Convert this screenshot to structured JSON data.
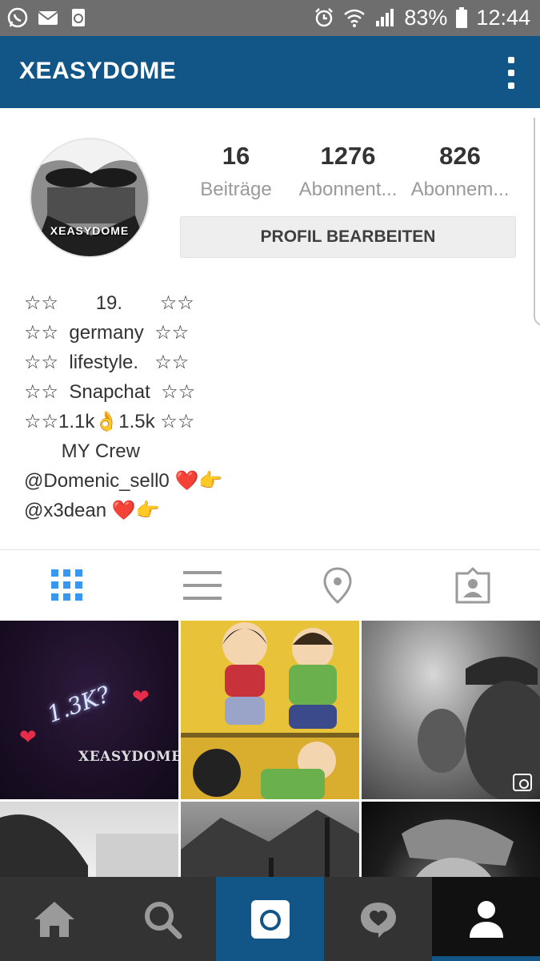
{
  "status_bar": {
    "left_icons": [
      "whatsapp-icon",
      "mail-icon",
      "recycle-icon"
    ],
    "alarm_icon": "alarm-clock-icon",
    "wifi_icon": "wifi-icon",
    "signal_icon": "signal-icon",
    "battery_percent": "83%",
    "battery_icon": "battery-icon",
    "time": "12:44"
  },
  "header": {
    "title": "XEASYDOME",
    "menu_icon": "kebab-menu-icon",
    "background": "#125688"
  },
  "profile": {
    "avatar_label": "XEASYDOME",
    "stats": [
      {
        "value": "16",
        "label": "Beiträge"
      },
      {
        "value": "1276",
        "label": "Abonnent..."
      },
      {
        "value": "826",
        "label": "Abonnem..."
      }
    ],
    "edit_button": "PROFIL BEARBEITEN",
    "bio": [
      "☆☆       19.       ☆☆",
      "☆☆  germany  ☆☆",
      "☆☆  lifestyle.   ☆☆",
      "☆☆  Snapchat  ☆☆",
      "☆☆1.1k👌1.5k ☆☆",
      "       MY Crew",
      "@Domenic_sell0 ❤️👉",
      "@x3dean ❤️👉"
    ]
  },
  "tabs": [
    {
      "icon": "grid-icon",
      "active": true
    },
    {
      "icon": "list-icon",
      "active": false
    },
    {
      "icon": "location-pin-icon",
      "active": false
    },
    {
      "icon": "tagged-person-icon",
      "active": false
    }
  ],
  "grid_tiles": [
    {
      "overlay_text": "1.3K?",
      "watermark": "XEASYDOME"
    },
    {
      "overlay_text": "",
      "watermark": ""
    },
    {
      "overlay_text": "",
      "watermark": ""
    },
    {
      "overlay_text": "",
      "watermark": ""
    },
    {
      "overlay_text": "",
      "watermark": ""
    },
    {
      "overlay_text": "",
      "watermark": ""
    }
  ],
  "bottom_nav": [
    {
      "icon": "home-icon"
    },
    {
      "icon": "search-icon"
    },
    {
      "icon": "camera-icon"
    },
    {
      "icon": "activity-heart-icon"
    },
    {
      "icon": "profile-icon",
      "active": true
    }
  ],
  "colors": {
    "accent": "#125688",
    "active_tab": "#3897f0",
    "inactive_icon": "#9a9a9a"
  }
}
